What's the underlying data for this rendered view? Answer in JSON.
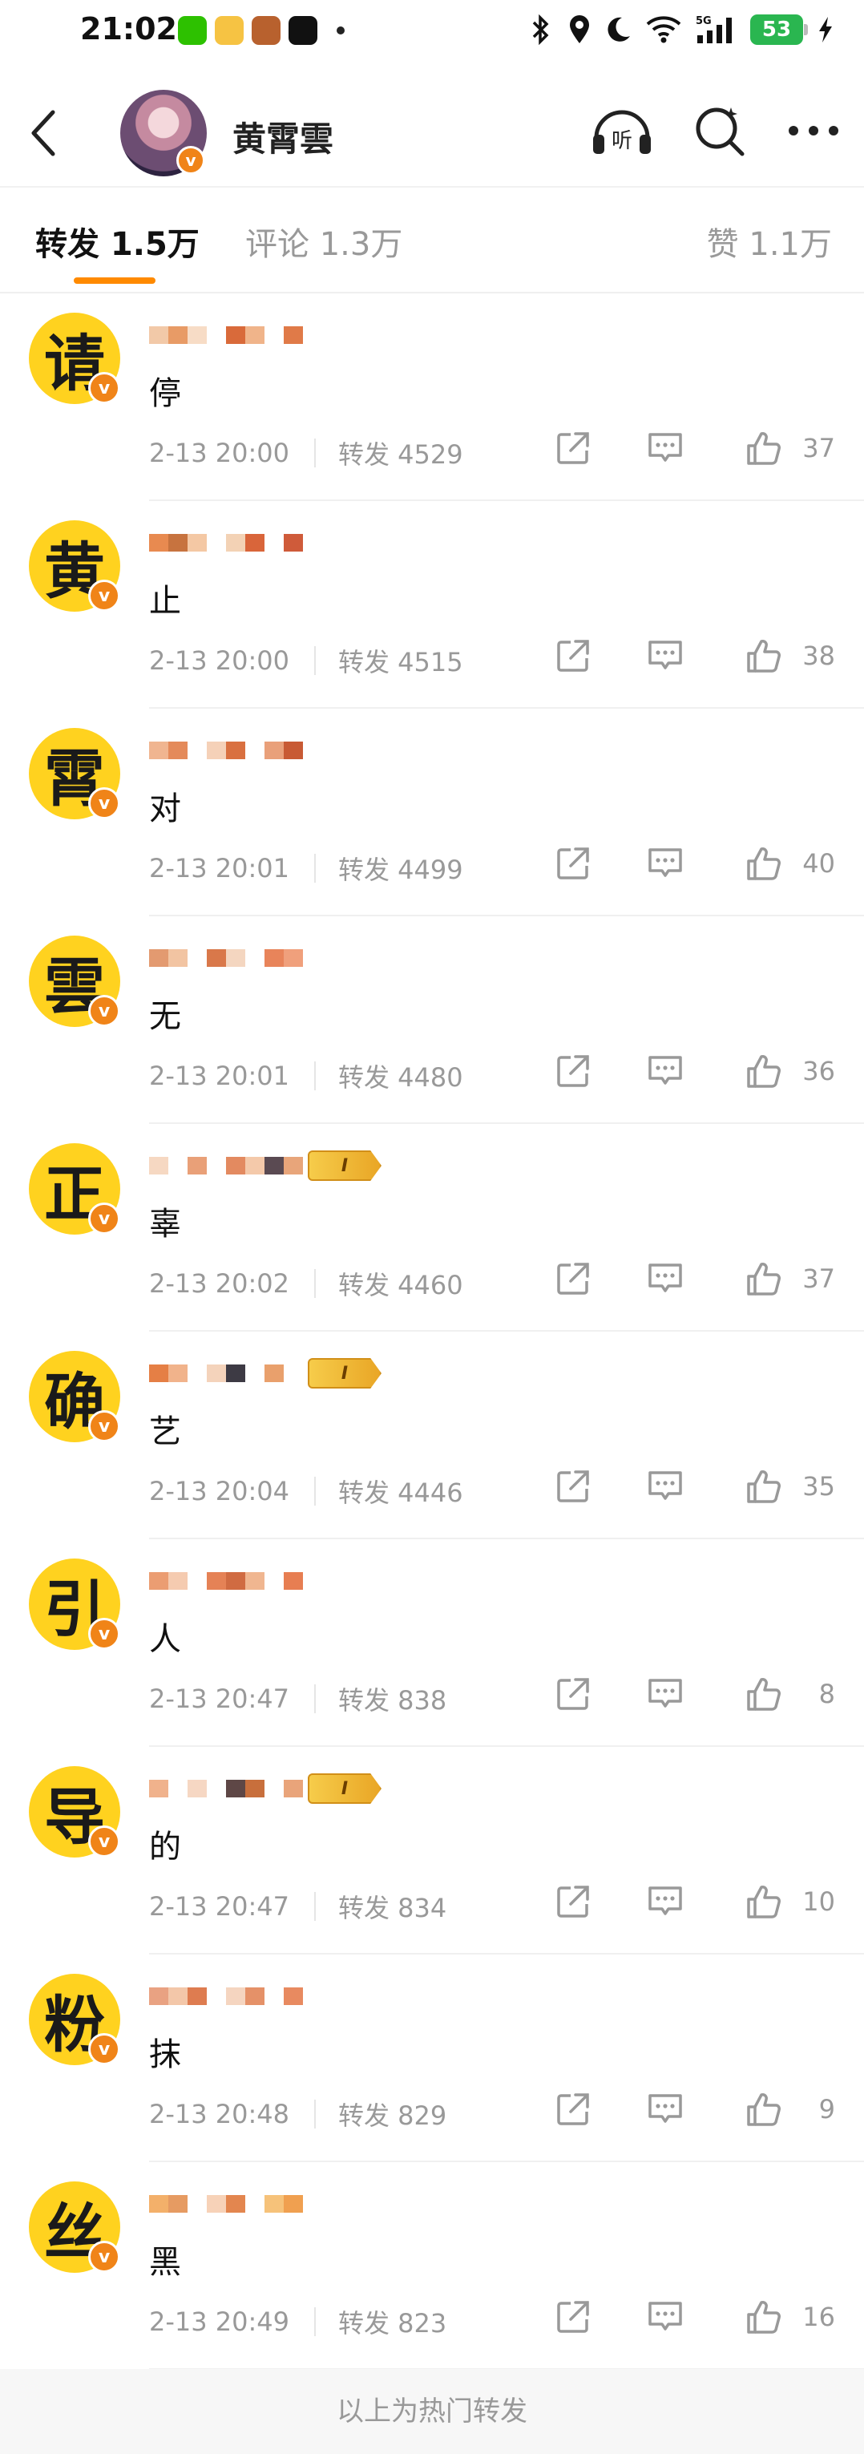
{
  "status": {
    "time": "21:02",
    "battery": "53",
    "network": "5G"
  },
  "nav": {
    "title": "黄霄雲"
  },
  "tabs": {
    "repost": "转发 1.5万",
    "comment": "评论 1.3万",
    "like": "赞 1.1万"
  },
  "items": [
    {
      "avatar_char": "请",
      "content": "停",
      "time": "2-13 20:00",
      "reposts": "转发 4529",
      "likes": "37",
      "badge": false
    },
    {
      "avatar_char": "黄",
      "content": "止",
      "time": "2-13 20:00",
      "reposts": "转发 4515",
      "likes": "38",
      "badge": false
    },
    {
      "avatar_char": "霄",
      "content": "对",
      "time": "2-13 20:01",
      "reposts": "转发 4499",
      "likes": "40",
      "badge": false
    },
    {
      "avatar_char": "雲",
      "content": "无",
      "time": "2-13 20:01",
      "reposts": "转发 4480",
      "likes": "36",
      "badge": false
    },
    {
      "avatar_char": "正",
      "content": "辜",
      "time": "2-13 20:02",
      "reposts": "转发 4460",
      "likes": "37",
      "badge": true
    },
    {
      "avatar_char": "确",
      "content": "艺",
      "time": "2-13 20:04",
      "reposts": "转发 4446",
      "likes": "35",
      "badge": true
    },
    {
      "avatar_char": "引",
      "content": "人",
      "time": "2-13 20:47",
      "reposts": "转发 838",
      "likes": "8",
      "badge": false
    },
    {
      "avatar_char": "导",
      "content": "的",
      "time": "2-13 20:47",
      "reposts": "转发 834",
      "likes": "10",
      "badge": true
    },
    {
      "avatar_char": "粉",
      "content": "抹",
      "time": "2-13 20:48",
      "reposts": "转发 829",
      "likes": "9",
      "badge": false
    },
    {
      "avatar_char": "丝",
      "content": "黑",
      "time": "2-13 20:49",
      "reposts": "转发 823",
      "likes": "16",
      "badge": false
    }
  ],
  "badge_text": "I",
  "verified_mark": "v",
  "footer": "以上为热门转发",
  "colors": {
    "accent": "#ff8a00",
    "avatar_bg": "#ffd21f",
    "verified": "#f08418",
    "muted_text": "#999999"
  }
}
